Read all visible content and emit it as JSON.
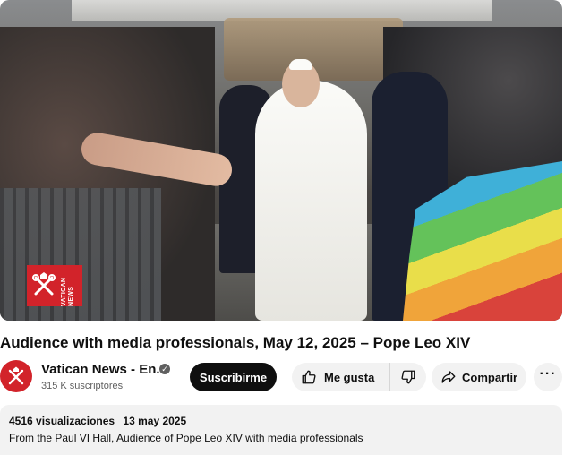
{
  "video": {
    "logo": {
      "text": "VATICAN NEWS",
      "color": "#d2232a"
    }
  },
  "title": "Audience with media professionals, May 12, 2025 – Pope Leo XIV",
  "channel": {
    "avatar_icon": "vatican-emblem-icon",
    "name": "Vatican News - En...",
    "verified_icon": "verified-check-icon",
    "subscribers": "315 K suscriptores"
  },
  "actions": {
    "subscribe_label": "Suscribirme",
    "like_label": "Me gusta",
    "like_icon": "thumbs-up-icon",
    "dislike_icon": "thumbs-down-icon",
    "share_label": "Compartir",
    "share_icon": "share-arrow-icon",
    "more_icon": "more-horizontal-icon"
  },
  "description": {
    "views": "4516 visualizaciones",
    "date": "13 may 2025",
    "text": "From the Paul VI Hall, Audience of Pope Leo XIV with media professionals"
  },
  "colors": {
    "brand_red": "#d2232a",
    "subscribe_bg": "#0f0f0f",
    "pill_bg": "#f2f2f2"
  }
}
